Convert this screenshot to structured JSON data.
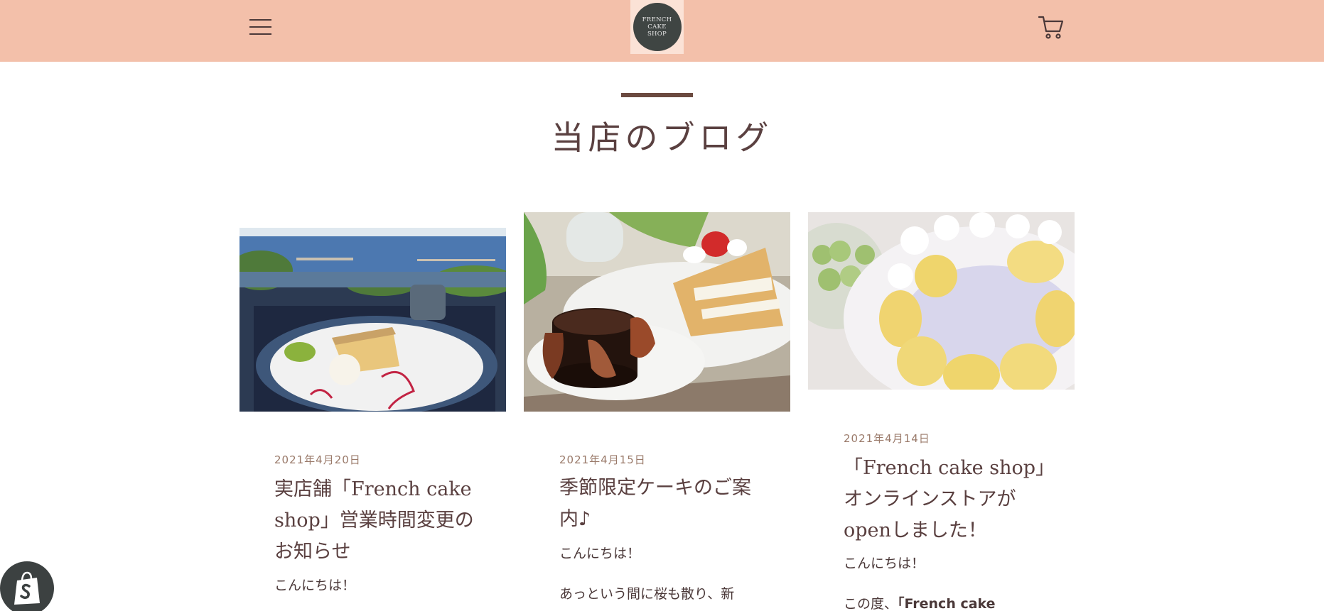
{
  "header": {
    "logo_lines": [
      "FRENCH",
      "CAKE",
      "SHOP"
    ],
    "menu_icon": "hamburger-menu-icon",
    "cart_icon": "shopping-cart-icon",
    "background": "#f3c0aa"
  },
  "blog": {
    "title": "当店のブログ",
    "posts": [
      {
        "date": "2021年4月20日",
        "title": "実店舗「French cake shop」営業時間変更のお知らせ",
        "excerpt_1": "こんにちは！",
        "excerpt_2": ""
      },
      {
        "date": "2021年4月15日",
        "title": "季節限定ケーキのご案内♪",
        "excerpt_1": "こんにちは！",
        "excerpt_2": "あっという間に桜も散り、新"
      },
      {
        "date": "2021年4月14日",
        "title": "「French cake shop」オンラインストアがopenしました！",
        "excerpt_1": "こんにちは！",
        "excerpt_2_prefix": "この度、",
        "excerpt_2_bold": "「French cake"
      }
    ]
  },
  "shopify_badge_icon": "shopify-bag-icon",
  "colors": {
    "accent_bar": "#6b4a40",
    "text": "#5a4040",
    "date": "#9a7a6a"
  }
}
